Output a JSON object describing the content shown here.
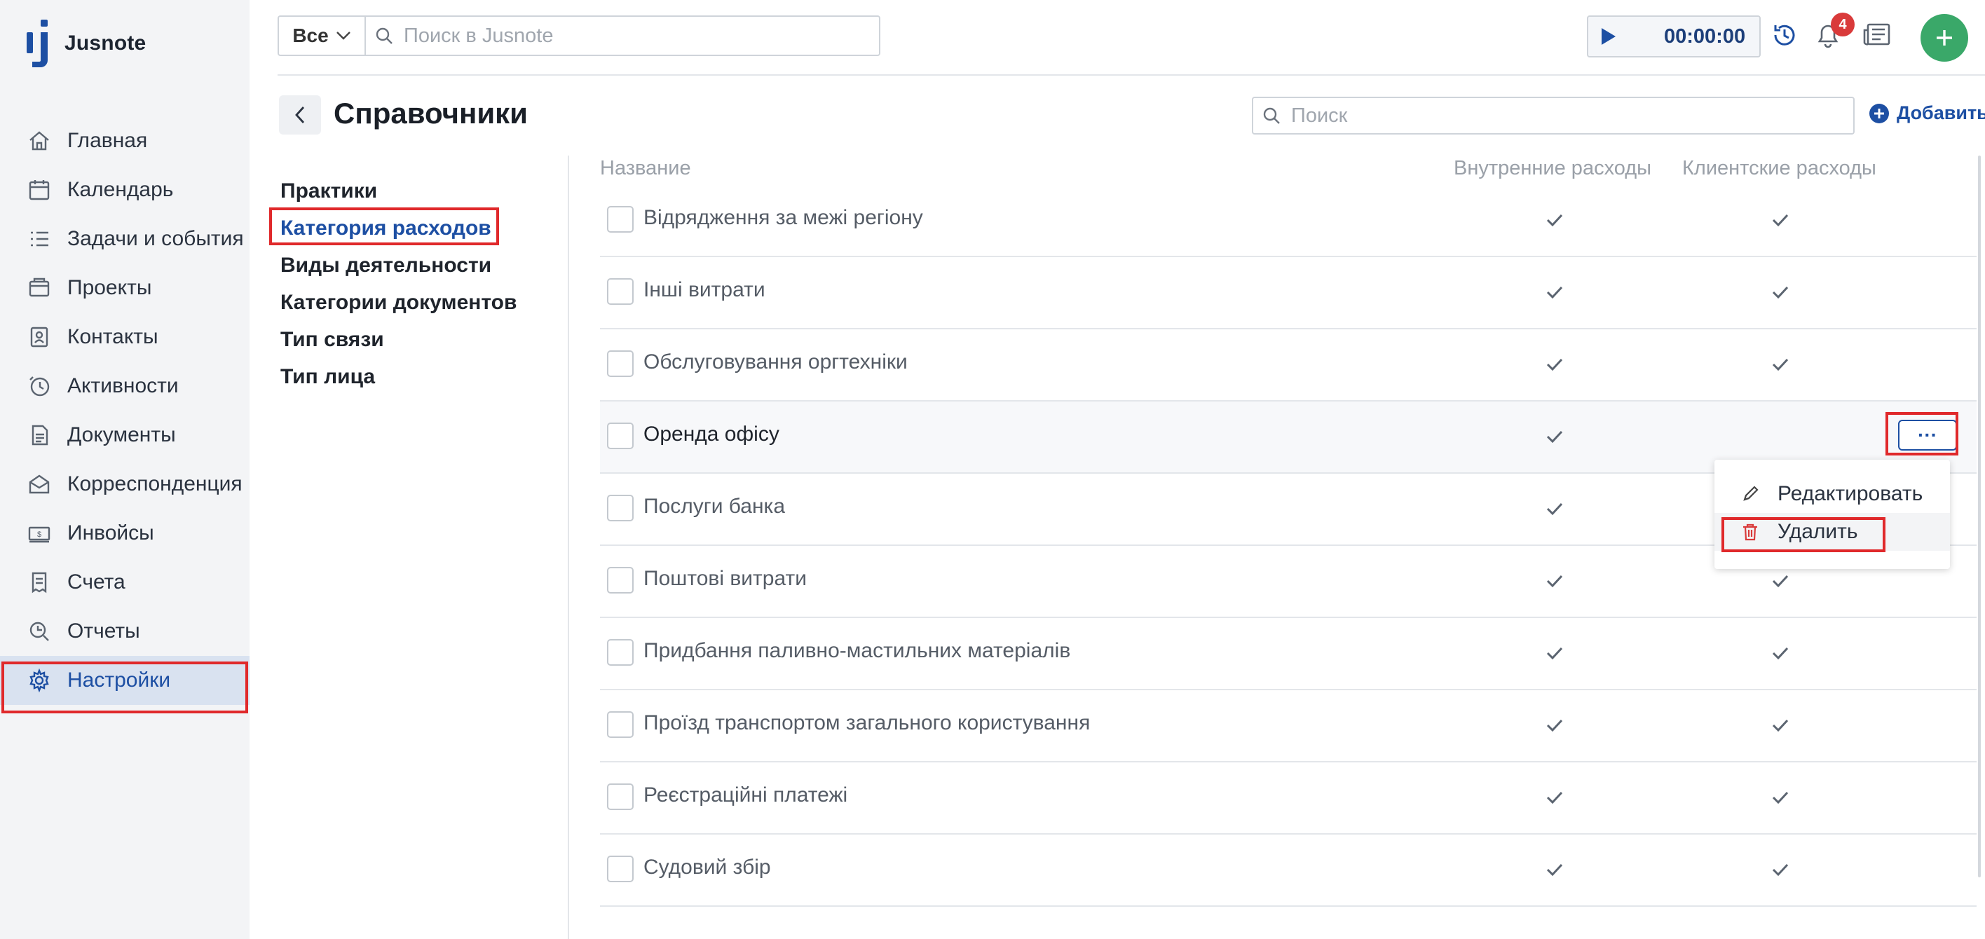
{
  "app": {
    "logo_text": "Jusnote"
  },
  "sidebar": {
    "items": [
      {
        "label": "Главная",
        "icon": "home-icon"
      },
      {
        "label": "Календарь",
        "icon": "calendar-icon"
      },
      {
        "label": "Задачи и события",
        "icon": "tasks-icon"
      },
      {
        "label": "Проекты",
        "icon": "projects-icon"
      },
      {
        "label": "Контакты",
        "icon": "contacts-icon"
      },
      {
        "label": "Активности",
        "icon": "activity-icon"
      },
      {
        "label": "Документы",
        "icon": "documents-icon"
      },
      {
        "label": "Корреспонденция",
        "icon": "mail-icon"
      },
      {
        "label": "Инвойсы",
        "icon": "invoice-icon"
      },
      {
        "label": "Счета",
        "icon": "bills-icon"
      },
      {
        "label": "Отчеты",
        "icon": "reports-icon"
      },
      {
        "label": "Настройки",
        "icon": "gear-icon",
        "active": true
      }
    ]
  },
  "topbar": {
    "scope_label": "Все",
    "search_placeholder": "Поиск в Jusnote",
    "timer": "00:00:00",
    "notifications_count": "4"
  },
  "page": {
    "title": "Справочники",
    "search_placeholder": "Поиск",
    "add_label": "Добавить"
  },
  "submenu": {
    "items": [
      {
        "label": "Практики"
      },
      {
        "label": "Категория расходов",
        "active": true
      },
      {
        "label": "Виды деятельности"
      },
      {
        "label": "Категории документов"
      },
      {
        "label": "Тип связи"
      },
      {
        "label": "Тип лица"
      }
    ]
  },
  "table": {
    "columns": [
      "Название",
      "Внутренние расходы",
      "Клиентские расходы"
    ],
    "rows": [
      {
        "name": "Відрядження за межі регіону",
        "internal": true,
        "client": true
      },
      {
        "name": "Інші витрати",
        "internal": true,
        "client": true
      },
      {
        "name": "Обслуговування оргтехніки",
        "internal": true,
        "client": true
      },
      {
        "name": "Оренда офісу",
        "internal": true,
        "client": false
      },
      {
        "name": "Послуги банка",
        "internal": true,
        "client": true
      },
      {
        "name": "Поштові витрати",
        "internal": true,
        "client": true
      },
      {
        "name": "Придбання паливно-мастильних матеріалів",
        "internal": true,
        "client": true
      },
      {
        "name": "Проїзд транспортом загального користування",
        "internal": true,
        "client": true
      },
      {
        "name": "Реєстраційні платежі",
        "internal": true,
        "client": true
      },
      {
        "name": "Судовий збір",
        "internal": true,
        "client": true
      }
    ],
    "more_label": "···"
  },
  "context_menu": {
    "edit_label": "Редактировать",
    "delete_label": "Удалить"
  },
  "colors": {
    "accent": "#1d4fa3",
    "highlight": "#e0292b",
    "add_button": "#3aa869",
    "badge": "#d93a3a"
  }
}
